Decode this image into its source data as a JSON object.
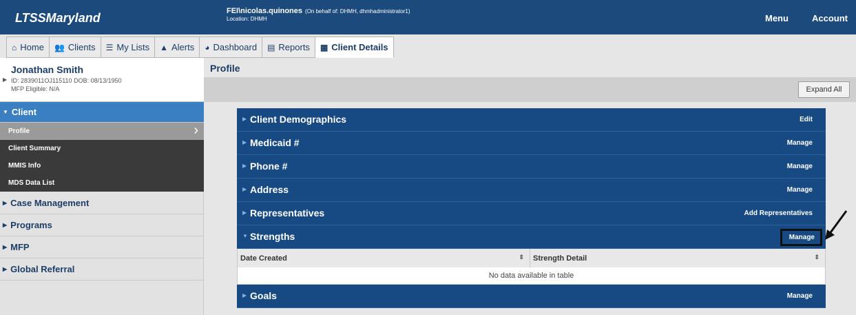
{
  "header": {
    "brand": "LTSSMaryland",
    "user": "FEI\\nicolas.quinones",
    "on_behalf": "(On behalf of: DHMH, dhmhadministrator1)",
    "location": "Location: DHMH",
    "menu_label": "Menu",
    "account_label": "Account"
  },
  "nav": {
    "tabs": [
      {
        "label": "Home",
        "icon": "home-icon"
      },
      {
        "label": "Clients",
        "icon": "users-icon"
      },
      {
        "label": "My Lists",
        "icon": "list-icon"
      },
      {
        "label": "Alerts",
        "icon": "warning-icon"
      },
      {
        "label": "Dashboard",
        "icon": "dashboard-icon"
      },
      {
        "label": "Reports",
        "icon": "reports-icon"
      },
      {
        "label": "Client Details",
        "icon": "client-card-icon",
        "active": true
      }
    ]
  },
  "client": {
    "name": "Jonathan Smith",
    "ids": "ID: 2839011OJ115110 DOB: 08/13/1950",
    "mfp": "MFP Eligible: N/A"
  },
  "sidebar": {
    "client_section": "Client",
    "client_items": [
      "Profile",
      "Client Summary",
      "MMIS Info",
      "MDS Data List"
    ],
    "sections": [
      "Case Management",
      "Programs",
      "MFP",
      "Global Referral"
    ]
  },
  "main": {
    "title": "Profile",
    "expand_all": "Expand All",
    "panels": [
      {
        "title": "Client Demographics",
        "action": "Edit"
      },
      {
        "title": "Medicaid #",
        "action": "Manage"
      },
      {
        "title": "Phone #",
        "action": "Manage"
      },
      {
        "title": "Address",
        "action": "Manage"
      },
      {
        "title": "Representatives",
        "action": "Add Representatives"
      },
      {
        "title": "Strengths",
        "action": "Manage",
        "expanded": true
      },
      {
        "title": "Goals",
        "action": "Manage"
      }
    ],
    "strengths_table": {
      "columns": [
        "Date Created",
        "Strength Detail"
      ],
      "empty_text": "No data available in table"
    }
  },
  "colors": {
    "header_blue": "#1d4a7c",
    "panel_blue": "#174a82",
    "sidebar_active": "#3a7fc1"
  }
}
